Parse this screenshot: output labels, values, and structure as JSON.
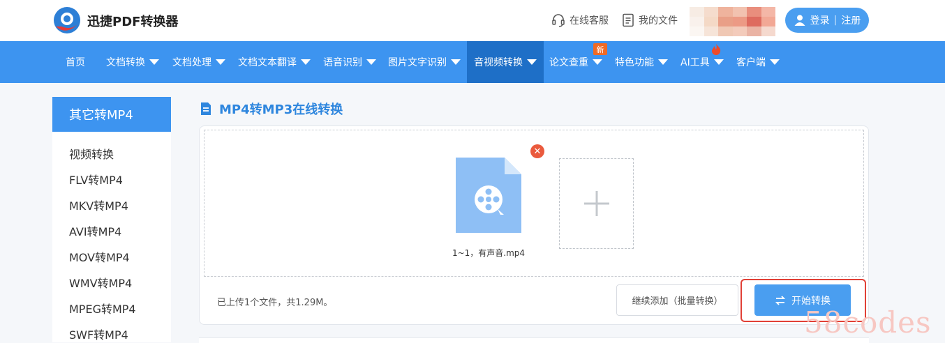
{
  "header": {
    "brand": "迅捷PDF转换器",
    "service_label": "在线客服",
    "files_label": "我的文件",
    "login_label": "登录",
    "register_label": "注册"
  },
  "nav": {
    "items": [
      {
        "label": "首页"
      },
      {
        "label": "文档转换"
      },
      {
        "label": "文档处理"
      },
      {
        "label": "文档文本翻译"
      },
      {
        "label": "语音识别"
      },
      {
        "label": "图片文字识别"
      },
      {
        "label": "音视频转换"
      },
      {
        "label": "论文查重"
      },
      {
        "label": "特色功能"
      },
      {
        "label": "AI工具"
      },
      {
        "label": "客户端"
      }
    ],
    "badge_new": "新",
    "active_color": "#1e6fc7",
    "bar_color": "#3d94f0"
  },
  "sidebar": {
    "title": "其它转MP4",
    "items": [
      {
        "label": "视频转换"
      },
      {
        "label": "FLV转MP4"
      },
      {
        "label": "MKV转MP4"
      },
      {
        "label": "AVI转MP4"
      },
      {
        "label": "MOV转MP4"
      },
      {
        "label": "WMV转MP4"
      },
      {
        "label": "MPEG转MP4"
      },
      {
        "label": "SWF转MP4"
      }
    ]
  },
  "main": {
    "title": "MP4转MP3在线转换",
    "file": {
      "name": "1~1，有声音.mp4",
      "icon": "video-file-icon"
    },
    "status": "已上传1个文件，共1.29M。",
    "continue_label": "继续添加（批量转换）",
    "start_label": "开始转换",
    "accent": "#4a9ef0",
    "highlight_color": "#e14036"
  },
  "watermark": "58codes"
}
